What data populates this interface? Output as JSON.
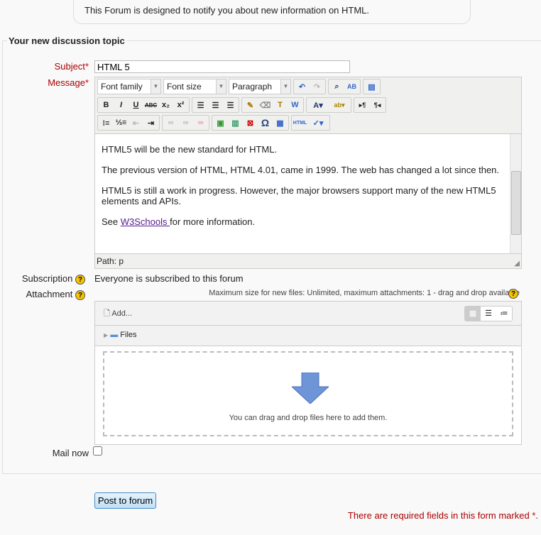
{
  "intro": "This Forum is designed to notify you about new information on HTML.",
  "legend": "Your new discussion topic",
  "subject": {
    "label": "Subject",
    "value": "HTML 5"
  },
  "message": {
    "label": "Message",
    "selects": [
      "Font family",
      "Font size",
      "Paragraph"
    ],
    "paragraphs": [
      "HTML5 will be the new standard for HTML.",
      "The previous version of HTML, HTML 4.01, came in 1999. The web has changed a lot since then.",
      "HTML5 is still a work in progress. However, the major browsers support many of the new HTML5 elements and APIs."
    ],
    "link_prefix": "See ",
    "link_text": "W3Schools ",
    "link_suffix": "for more information.",
    "path": "Path: p"
  },
  "subscription": {
    "label": "Subscription",
    "value": "Everyone is subscribed to this forum"
  },
  "attachment": {
    "label": "Attachment",
    "max_info": "Maximum size for new files: Unlimited, maximum attachments: 1 - drag and drop available",
    "add": "Add...",
    "files": "Files",
    "drop_text": "You can drag and drop files here to add them."
  },
  "mail_now": {
    "label": "Mail now",
    "checked": false
  },
  "submit": "Post to forum",
  "required_note": "There are required fields in this form marked",
  "required_star": "*",
  "colors": {
    "required": "#aa0000",
    "link": "#551a8b"
  }
}
